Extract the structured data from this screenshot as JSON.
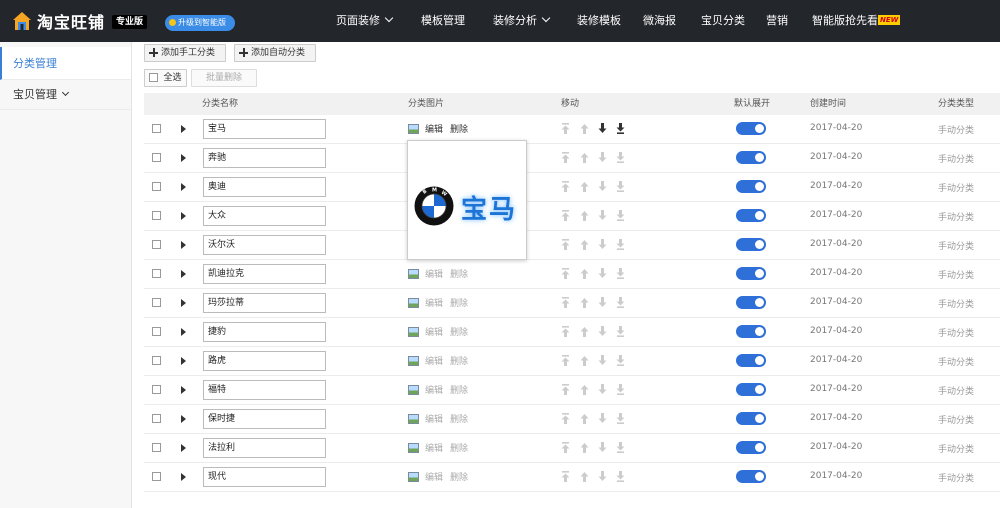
{
  "app": {
    "logo_text": "淘宝旺铺",
    "edition": "专业版",
    "upgrade_label": "升级到智能版",
    "nav": [
      {
        "label": "页面装修",
        "dropdown": true
      },
      {
        "label": "模板管理",
        "dropdown": false
      },
      {
        "label": "装修分析",
        "dropdown": true
      },
      {
        "label": "装修模板",
        "dropdown": false
      },
      {
        "label": "微海报",
        "dropdown": false
      },
      {
        "label": "宝贝分类",
        "dropdown": false
      },
      {
        "label": "营销",
        "dropdown": false
      },
      {
        "label": "智能版抢先看",
        "dropdown": false
      }
    ],
    "new_badge": "NEW"
  },
  "sidebar": {
    "items": [
      {
        "label": "分类管理",
        "active": true
      },
      {
        "label": "宝贝管理",
        "active": false
      }
    ]
  },
  "toolbar": {
    "add_manual": "添加手工分类",
    "add_auto": "添加自动分类",
    "select_all": "全选",
    "batch_delete": "批量删除"
  },
  "table": {
    "headers": {
      "name": "分类名称",
      "image": "分类图片",
      "move": "移动",
      "expand_default": "默认展开",
      "created": "创建时间",
      "type": "分类类型"
    },
    "edit_label": "编辑",
    "delete_label": "删除",
    "rows": [
      {
        "name": "宝马",
        "created": "2017-04-20",
        "type": "手动分类",
        "expanded": true
      },
      {
        "name": "奔驰",
        "created": "2017-04-20",
        "type": "手动分类",
        "expanded": true
      },
      {
        "name": "奥迪",
        "created": "2017-04-20",
        "type": "手动分类",
        "expanded": true
      },
      {
        "name": "大众",
        "created": "2017-04-20",
        "type": "手动分类",
        "expanded": true
      },
      {
        "name": "沃尔沃",
        "created": "2017-04-20",
        "type": "手动分类",
        "expanded": true
      },
      {
        "name": "凯迪拉克",
        "created": "2017-04-20",
        "type": "手动分类",
        "expanded": true
      },
      {
        "name": "玛莎拉蒂",
        "created": "2017-04-20",
        "type": "手动分类",
        "expanded": true
      },
      {
        "name": "捷豹",
        "created": "2017-04-20",
        "type": "手动分类",
        "expanded": true
      },
      {
        "name": "路虎",
        "created": "2017-04-20",
        "type": "手动分类",
        "expanded": true
      },
      {
        "name": "福特",
        "created": "2017-04-20",
        "type": "手动分类",
        "expanded": true
      },
      {
        "name": "保时捷",
        "created": "2017-04-20",
        "type": "手动分类",
        "expanded": true
      },
      {
        "name": "法拉利",
        "created": "2017-04-20",
        "type": "手动分类",
        "expanded": true
      },
      {
        "name": "现代",
        "created": "2017-04-20",
        "type": "手动分类",
        "expanded": true
      }
    ]
  },
  "preview": {
    "logo_letters": "BMW",
    "caption": "宝马"
  },
  "colors": {
    "topbar_bg": "#23262b",
    "accent": "#2f6fd8",
    "sidebar_active": "#3a7fd5"
  }
}
